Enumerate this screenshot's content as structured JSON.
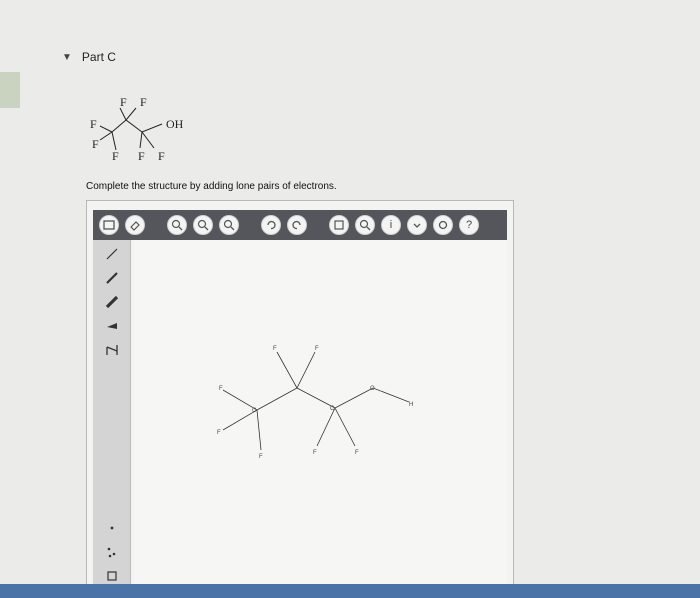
{
  "part": {
    "caret": "▼",
    "title": "Part C"
  },
  "structure_labels": {
    "f1": "F",
    "f2": "F",
    "f3": "F",
    "f4": "F",
    "f5": "F",
    "f6": "F",
    "f7": "F",
    "oh": "OH"
  },
  "instruction": "Complete the structure by adding lone pairs of electrons.",
  "toolbar": {
    "icons": [
      "select-icon",
      "eraser-icon",
      "zoom-in-icon",
      "zoom-out-icon",
      "zoom-fit-icon",
      "undo-icon",
      "redo-icon",
      "template-icon",
      "search-icon",
      "info-icon",
      "more-icon",
      "settings-icon",
      "help-icon"
    ],
    "info_glyph": "i",
    "help_glyph": "?"
  },
  "side_tools": [
    "single-bond-icon",
    "double-bond-icon",
    "triple-bond-icon",
    "wedge-bond-icon",
    "hash-bond-icon",
    "lone-pair-icon",
    "radical-icon",
    "charge-box-icon"
  ],
  "canvas_labels": {
    "c1": "C",
    "c2": "C",
    "o": "O",
    "h": "H",
    "f1": "F",
    "f2": "F",
    "f3": "F",
    "f4": "F",
    "f5": "F",
    "f6": "F",
    "f7": "F"
  },
  "colors": {
    "toolbar": "#55565b",
    "accent_strip": "#4b73a8"
  }
}
